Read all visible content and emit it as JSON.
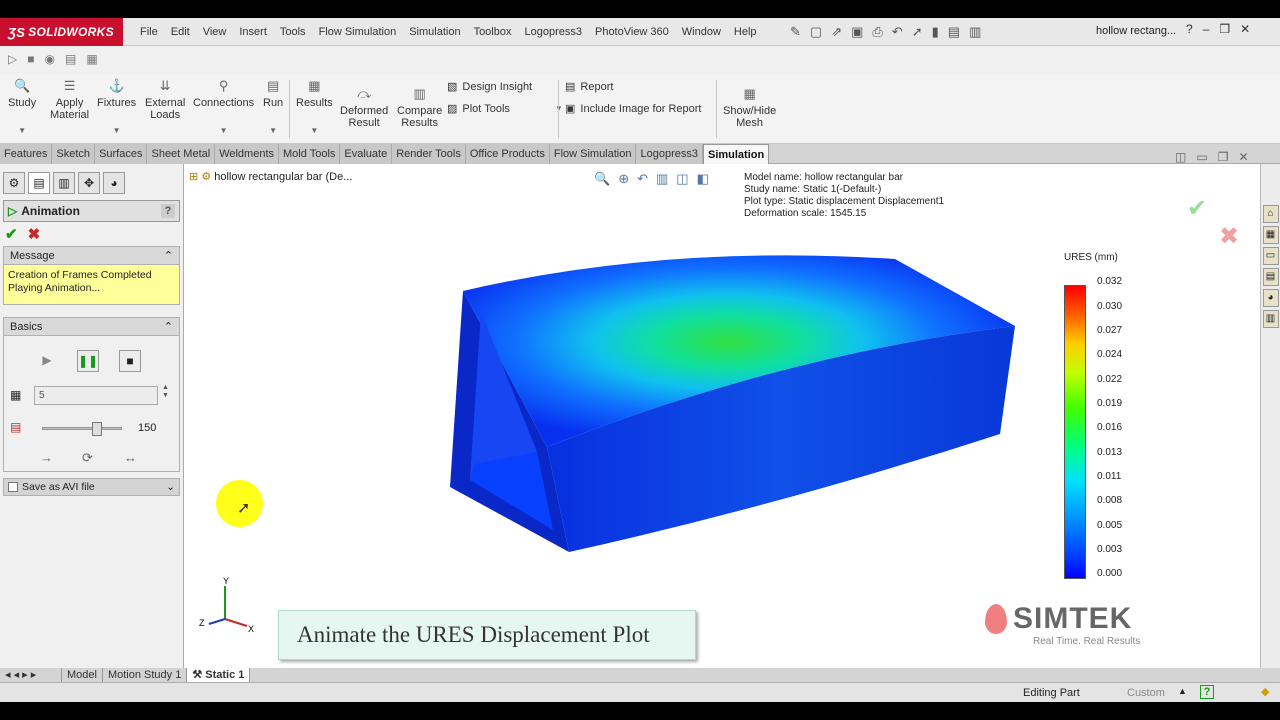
{
  "app": {
    "logo": "SOLIDWORKS",
    "document_title": "hollow rectang..."
  },
  "menu": [
    "File",
    "Edit",
    "View",
    "Insert",
    "Tools",
    "Flow Simulation",
    "Simulation",
    "Toolbox",
    "Logopress3",
    "PhotoView 360",
    "Window",
    "Help"
  ],
  "ribbon": {
    "study": "Study",
    "apply_material": [
      "Apply",
      "Material"
    ],
    "fixtures": "Fixtures",
    "external_loads": [
      "External",
      "Loads"
    ],
    "connections": "Connections",
    "run": "Run",
    "results": "Results",
    "deformed_result": [
      "Deformed",
      "Result"
    ],
    "compare_results": [
      "Compare",
      "Results"
    ],
    "design_insight": "Design Insight",
    "plot_tools": "Plot Tools",
    "report": "Report",
    "include_image": "Include Image for Report",
    "show_hide_mesh": [
      "Show/Hide",
      "Mesh"
    ]
  },
  "command_tabs": [
    "Features",
    "Sketch",
    "Surfaces",
    "Sheet Metal",
    "Weldments",
    "Mold Tools",
    "Evaluate",
    "Render Tools",
    "Office Products",
    "Flow Simulation",
    "Logopress3",
    "Simulation"
  ],
  "active_command_tab": "Simulation",
  "panel": {
    "title": "Animation",
    "help": "?",
    "message_header": "Message",
    "message_lines": [
      "Creation of Frames Completed",
      "Playing Animation..."
    ],
    "basics_header": "Basics",
    "frames_value": "5",
    "speed_value": "150",
    "speed_fraction": 0.72,
    "save_avi": "Save as AVI file"
  },
  "viewport": {
    "tree_label": "hollow rectangular bar  (De...",
    "plot_info": {
      "model_name": "Model name: hollow rectangular bar",
      "study_name": "Study name: Static 1(-Default-)",
      "plot_type": "Plot type: Static displacement Displacement1",
      "deformation_scale": "Deformation scale: 1545.15"
    },
    "legend": {
      "title": "URES (mm)",
      "ticks": [
        "0.032",
        "0.030",
        "0.027",
        "0.024",
        "0.022",
        "0.019",
        "0.016",
        "0.013",
        "0.011",
        "0.008",
        "0.005",
        "0.003",
        "0.000"
      ]
    },
    "caption": "Animate the URES Displacement Plot",
    "brand": {
      "name": "SIMTEK",
      "tagline": "Real Time. Real Results"
    },
    "triad": {
      "y": "Y",
      "x": "X",
      "z": "Z"
    }
  },
  "bottom_tabs": [
    "Model",
    "Motion Study 1",
    "Static 1"
  ],
  "active_bottom_tab": "Static 1",
  "status": {
    "editing": "Editing Part",
    "custom": "Custom"
  },
  "colors": {
    "logo_red": "#c8102e",
    "message_yellow": "#ffff99",
    "ok_green": "#1a9a1a",
    "cancel_red": "#c62828"
  }
}
